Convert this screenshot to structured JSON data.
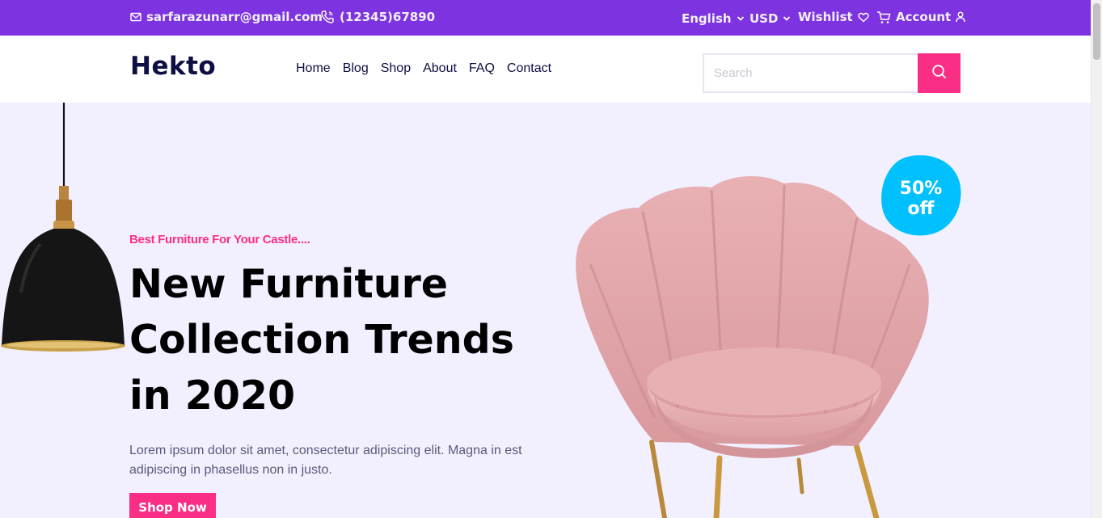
{
  "topbar": {
    "email": "sarfarazunarr@gmail.com",
    "phone": "(12345)67890",
    "language": "English",
    "currency": "USD",
    "wishlist": "Wishlist",
    "account": "Account"
  },
  "header": {
    "logo": "Hekto",
    "nav": [
      "Home",
      "Blog",
      "Shop",
      "About",
      "FAQ",
      "Contact"
    ],
    "search_placeholder": "Search"
  },
  "hero": {
    "tagline": "Best Furniture For Your Castle....",
    "headline_line1": "New Furniture",
    "headline_line2": "Collection Trends",
    "headline_line3": "in 2020",
    "description": "Lorem ipsum dolor sit amet, consectetur adipiscing elit. Magna in est adipiscing in phasellus non in justo.",
    "button": "Shop Now",
    "badge_line1": "50%",
    "badge_line2": "off"
  },
  "colors": {
    "topbar": "#7e33e0",
    "accent": "#fb2e86",
    "hero_bg": "#f2f0ff",
    "badge": "#00c1fe",
    "navy": "#0d0e43"
  }
}
